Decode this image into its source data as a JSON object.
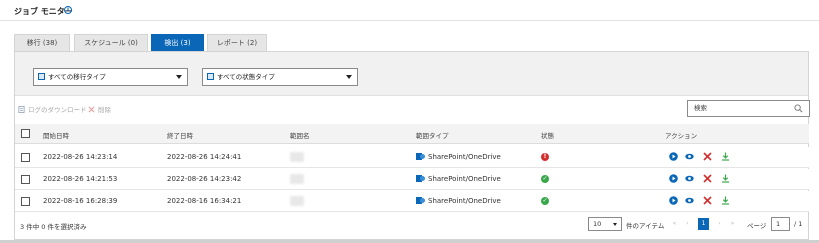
{
  "header": {
    "title": "ジョブ モニター",
    "info_icon": "info-icon"
  },
  "tabs": [
    {
      "label": "移行 (38)"
    },
    {
      "label": "スケジュール (0)"
    },
    {
      "label": "検出 (3)"
    },
    {
      "label": "レポート (2)"
    }
  ],
  "filters": {
    "migration_type": "すべての移行タイプ",
    "status_type": "すべての状態タイプ"
  },
  "toolbar": {
    "download_log": "ログのダウンロード",
    "delete": "削除"
  },
  "search": {
    "placeholder": "検索"
  },
  "table": {
    "columns": [
      "開始日時",
      "終了日時",
      "範囲名",
      "範囲タイプ",
      "状態",
      "アクション"
    ],
    "rows": [
      {
        "start": "2022-08-26 14:23:14",
        "end": "2022-08-26 14:24:41",
        "scope_type": "SharePoint/OneDrive",
        "status": "failed"
      },
      {
        "start": "2022-08-26 14:21:53",
        "end": "2022-08-26 14:23:42",
        "scope_type": "SharePoint/OneDrive",
        "status": "success"
      },
      {
        "start": "2022-08-16 16:28:39",
        "end": "2022-08-16 16:34:21",
        "scope_type": "SharePoint/OneDrive",
        "status": "success"
      }
    ]
  },
  "footer": {
    "selection_count": "3 件中 0 件を選択済み",
    "page_size": "10",
    "items_label": "件のアイテム",
    "current_page": "1",
    "page_label": "ページ",
    "page_input": "1",
    "total_pages": "/ 1"
  },
  "colors": {
    "accent": "#0a66b7",
    "error": "#d32f2f",
    "success": "#3aa84a"
  }
}
